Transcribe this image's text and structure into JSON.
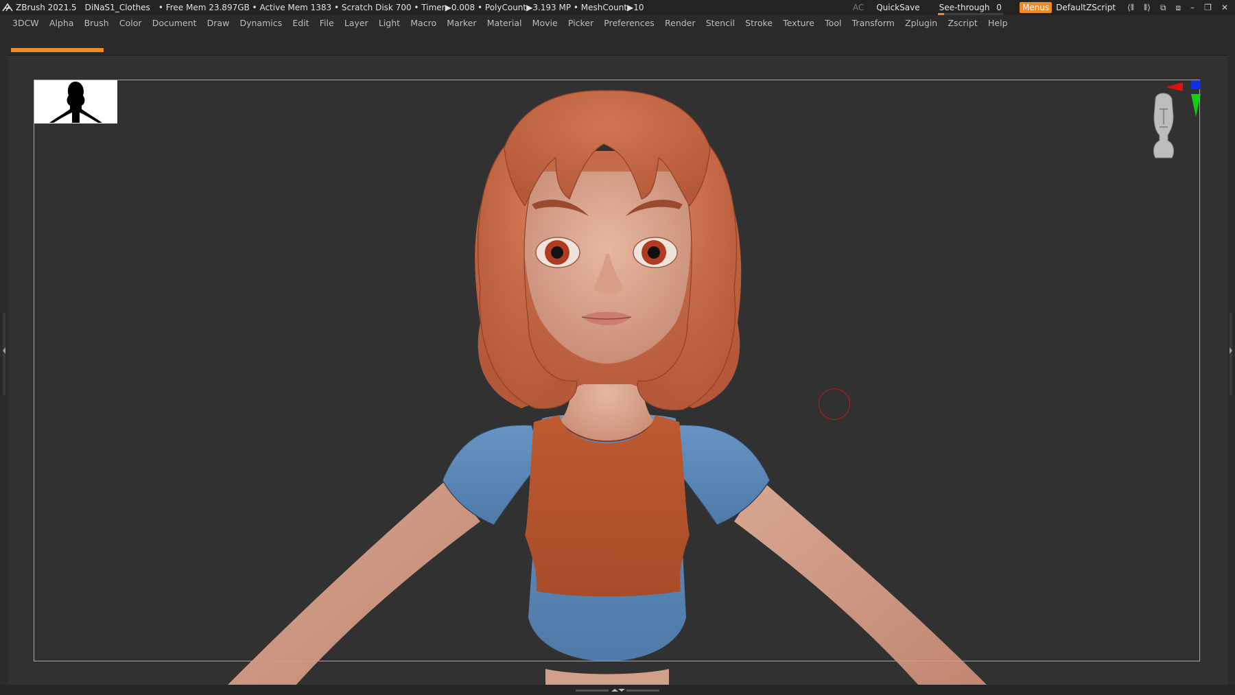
{
  "titlebar": {
    "app": "ZBrush 2021.5",
    "document": "DiNaS1_Clothes",
    "stats": "• Free Mem 23.897GB • Active Mem 1383 • Scratch Disk 700 •  Timer▶0.008 • PolyCount▶3.193 MP  • MeshCount▶10",
    "ac": "AC",
    "quicksave": "QuickSave",
    "see_through_label": "See-through",
    "see_through_value": "0",
    "see_through_fill": 0.1,
    "menus": "Menus",
    "script": "DefaultZScript",
    "accent": "#f08a24"
  },
  "menubar": {
    "items": [
      "3DCW",
      "Alpha",
      "Brush",
      "Color",
      "Document",
      "Draw",
      "Dynamics",
      "Edit",
      "File",
      "Layer",
      "Light",
      "Macro",
      "Marker",
      "Material",
      "Movie",
      "Picker",
      "Preferences",
      "Render",
      "Stencil",
      "Stroke",
      "Texture",
      "Tool",
      "Transform",
      "Zplugin",
      "Zscript",
      "Help"
    ]
  },
  "colors": {
    "skin": "#d8a58f",
    "hair": "#c76a45",
    "shirt": "#5b88b8",
    "vest": "#b6532d",
    "eyes": "#b13a22",
    "brush_ring": "#b02020"
  },
  "icons": {
    "logo": "zbrush-logo-icon",
    "navcube": "head-navcube-icon",
    "window_controls": [
      "minimize-icon",
      "restore-icon",
      "close-icon"
    ]
  }
}
